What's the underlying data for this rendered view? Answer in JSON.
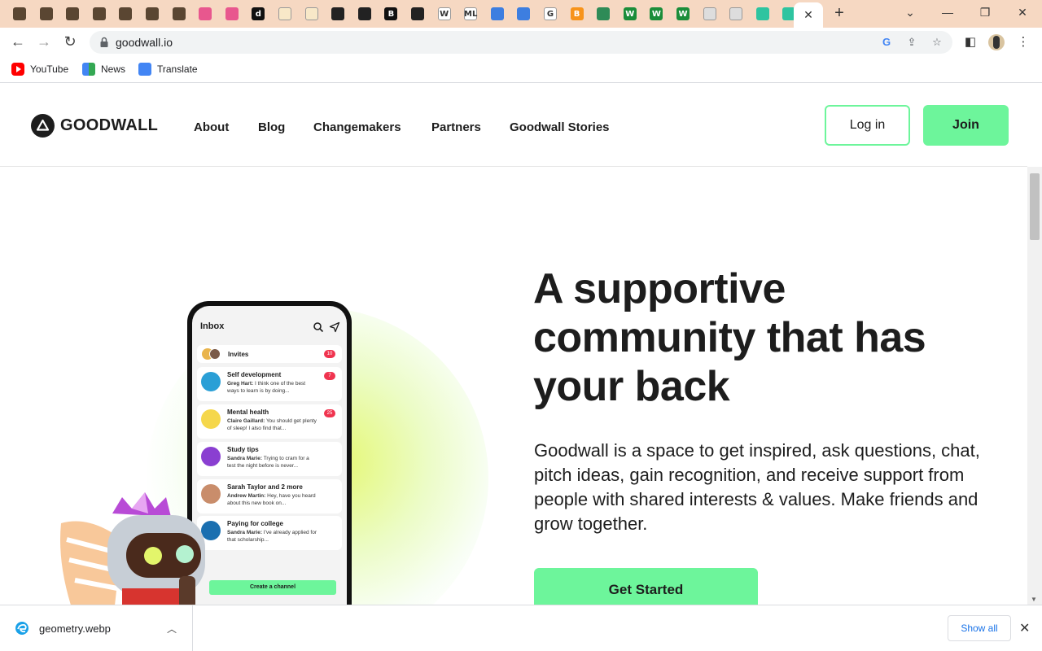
{
  "browser": {
    "url": "goodwall.io",
    "bookmarks": [
      {
        "label": "YouTube"
      },
      {
        "label": "News"
      },
      {
        "label": "Translate"
      }
    ],
    "tab_favicons": [
      {
        "letter": "",
        "color": "#5a4632"
      },
      {
        "letter": "",
        "color": "#5a4632"
      },
      {
        "letter": "",
        "color": "#5a4632"
      },
      {
        "letter": "",
        "color": "#5a4632"
      },
      {
        "letter": "",
        "color": "#5a4632"
      },
      {
        "letter": "",
        "color": "#5a4632"
      },
      {
        "letter": "",
        "color": "#5a4632"
      },
      {
        "letter": "",
        "color": "#e8578e"
      },
      {
        "letter": "",
        "color": "#e8578e"
      },
      {
        "letter": "d",
        "color": "#111111"
      },
      {
        "letter": "",
        "color": "#f8e8c8"
      },
      {
        "letter": "",
        "color": "#f8e8c8"
      },
      {
        "letter": "",
        "color": "#222222"
      },
      {
        "letter": "",
        "color": "#222222"
      },
      {
        "letter": "B",
        "color": "#111111"
      },
      {
        "letter": "",
        "color": "#222222"
      },
      {
        "letter": "W",
        "color": "#ffffff"
      },
      {
        "letter": "ML",
        "color": "#ffffff"
      },
      {
        "letter": "",
        "color": "#3d7ee0"
      },
      {
        "letter": "",
        "color": "#3d7ee0"
      },
      {
        "letter": "G",
        "color": "#ffffff"
      },
      {
        "letter": "B",
        "color": "#f7931a"
      },
      {
        "letter": "",
        "color": "#2e8b57"
      },
      {
        "letter": "W",
        "color": "#1a8d3a"
      },
      {
        "letter": "W",
        "color": "#1a8d3a"
      },
      {
        "letter": "W",
        "color": "#1a8d3a"
      },
      {
        "letter": "",
        "color": "#dddddd"
      },
      {
        "letter": "",
        "color": "#dddddd"
      },
      {
        "letter": "",
        "color": "#2ec4a0"
      },
      {
        "letter": "",
        "color": "#2ec4a0"
      }
    ]
  },
  "site": {
    "logo_text": "GOODWALL",
    "nav": [
      {
        "label": "About"
      },
      {
        "label": "Blog"
      },
      {
        "label": "Changemakers"
      },
      {
        "label": "Partners"
      },
      {
        "label": "Goodwall Stories"
      }
    ],
    "login_label": "Log in",
    "join_label": "Join"
  },
  "hero": {
    "title": "A supportive community that has your back",
    "description": "Goodwall is a space to get inspired, ask questions, chat, pitch ideas, gain recognition, and receive support from people with shared interests & values. Make friends and grow together.",
    "cta_label": "Get Started"
  },
  "phone": {
    "inbox_title": "Inbox",
    "invites": {
      "title": "Invites",
      "badge": "10"
    },
    "rows": [
      {
        "title": "Self development",
        "author": "Greg Hart:",
        "text": " I think one of the best ways to learn is by doing...",
        "badge": "7",
        "color": "#2a9fd6"
      },
      {
        "title": "Mental health",
        "author": "Claire Gaillard:",
        "text": " You should get plenty of sleep! I also find that...",
        "badge": "25",
        "color": "#f5d74b"
      },
      {
        "title": "Study tips",
        "author": "Sandra Marie:",
        "text": " Trying to cram for a test the night before is never...",
        "badge": "",
        "color": "#8a3fd1"
      },
      {
        "title": "Sarah Taylor and 2 more",
        "author": "Andrew Martin:",
        "text": " Hey, have you heard about this new book on...",
        "badge": "",
        "color": "#c98d6b"
      },
      {
        "title": "Paying for college",
        "author": "Sandra Marie:",
        "text": " I've already applied for that scholarship...",
        "badge": "",
        "color": "#1a6fb0"
      }
    ],
    "create_label": "Create a channel"
  },
  "download": {
    "filename": "geometry.webp",
    "show_all_label": "Show all"
  },
  "colors": {
    "accent_green": "#6df59b",
    "tabstrip": "#f6d8c2",
    "badge_red": "#f0344f"
  }
}
